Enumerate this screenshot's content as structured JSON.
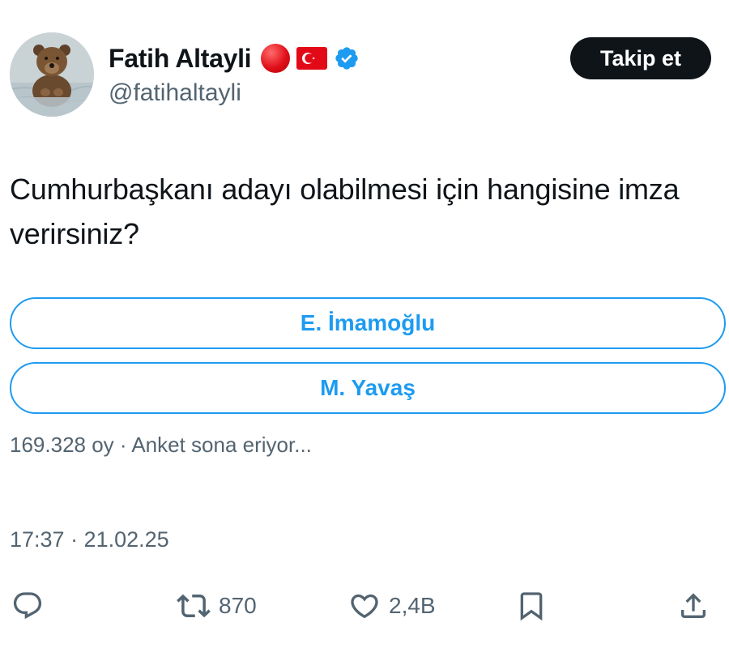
{
  "author": {
    "display_name": "Fatih Altayli",
    "handle": "@fatihaltayli",
    "badges": [
      "red-circle-icon",
      "turkey-flag-icon",
      "verified-badge-icon"
    ]
  },
  "follow_button": {
    "label": "Takip et"
  },
  "tweet": {
    "text": "Cumhurbaşkanı adayı olabilmesi için hangisine imza verirsiniz?"
  },
  "poll": {
    "options": [
      {
        "label": "E. İmamoğlu"
      },
      {
        "label": "M. Yavaş"
      }
    ],
    "meta": "169.328 oy · Anket sona eriyor..."
  },
  "timestamp": "17:37 · 21.02.25",
  "actions": {
    "reply": {
      "icon": "reply-icon",
      "count": ""
    },
    "retweet": {
      "icon": "retweet-icon",
      "count": "870"
    },
    "like": {
      "icon": "heart-icon",
      "count": "2,4B"
    },
    "bookmark": {
      "icon": "bookmark-icon"
    },
    "share": {
      "icon": "share-icon"
    }
  },
  "colors": {
    "accent": "#1d9bf0",
    "text": "#0f1419",
    "muted": "#536471",
    "button_bg": "#0f1419"
  }
}
